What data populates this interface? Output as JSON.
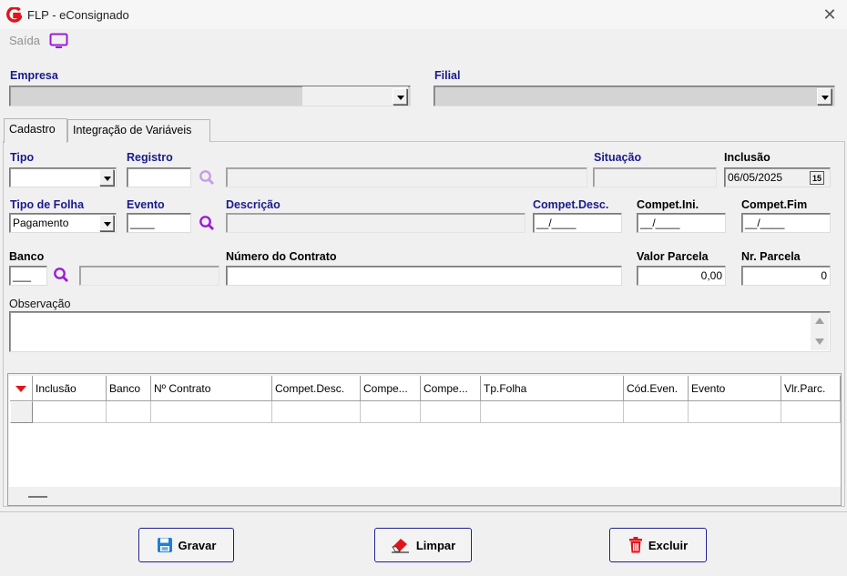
{
  "window": {
    "title": "FLP - eConsignado",
    "close_glyph": "✕"
  },
  "toolbar": {
    "saida_label": "Saída",
    "saida_icon": "monitor-icon"
  },
  "header": {
    "empresa_label": "Empresa",
    "filial_label": "Filial"
  },
  "tabs": [
    {
      "label": "Cadastro",
      "active": true
    },
    {
      "label": "Integração de Variáveis",
      "active": false
    }
  ],
  "form": {
    "tipo_label": "Tipo",
    "registro_label": "Registro",
    "situacao_label": "Situação",
    "inclusao_label": "Inclusão",
    "inclusao_value": "06/05/2025",
    "tipo_folha_label": "Tipo de Folha",
    "tipo_folha_value": "Pagamento",
    "evento_label": "Evento",
    "evento_value": "____",
    "descricao_label": "Descrição",
    "compet_desc_label": "Compet.Desc.",
    "compet_desc_value": "__/____",
    "compet_ini_label": "Compet.Ini.",
    "compet_ini_value": "__/____",
    "compet_fim_label": "Compet.Fim",
    "compet_fim_value": "__/____",
    "banco_label": "Banco",
    "banco_value": "___",
    "numero_contrato_label": "Número do Contrato",
    "valor_parcela_label": "Valor Parcela",
    "valor_parcela_value": "0,00",
    "nr_parcela_label": "Nr. Parcela",
    "nr_parcela_value": "0",
    "observacao_label": "Observação"
  },
  "grid": {
    "columns": [
      "Inclusão",
      "Banco",
      "Nº Contrato",
      "Compet.Desc.",
      "Compe...",
      "Compe...",
      "Tp.Folha",
      "Cód.Even.",
      "Evento",
      "Vlr.Parc."
    ]
  },
  "buttons": {
    "gravar": "Gravar",
    "limpar": "Limpar",
    "excluir": "Excluir"
  },
  "colors": {
    "label_blue": "#1a1a8c",
    "accent_purple": "#9b1bd6",
    "logo_red": "#e0151c"
  }
}
